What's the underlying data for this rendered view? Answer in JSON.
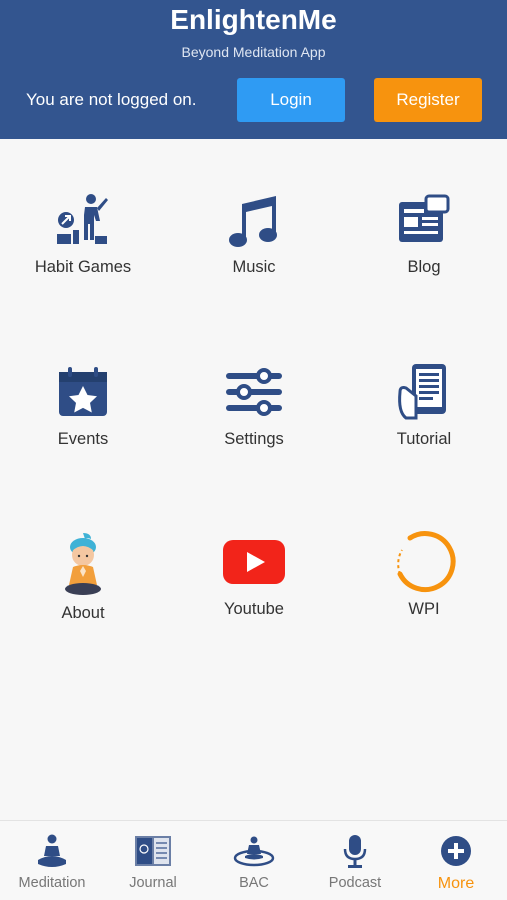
{
  "header": {
    "title": "EnlightenMe",
    "subtitle": "Beyond Meditation App",
    "status_text": "You are not logged on.",
    "login_label": "Login",
    "register_label": "Register"
  },
  "menu": {
    "items": [
      {
        "label": "Habit Games",
        "icon": "habit-games-icon"
      },
      {
        "label": "Music",
        "icon": "music-note-icon"
      },
      {
        "label": "Blog",
        "icon": "blog-icon"
      },
      {
        "label": "Events",
        "icon": "calendar-star-icon"
      },
      {
        "label": "Settings",
        "icon": "sliders-icon"
      },
      {
        "label": "Tutorial",
        "icon": "tablet-hand-icon"
      },
      {
        "label": "About",
        "icon": "meditating-child-icon"
      },
      {
        "label": "Youtube",
        "icon": "youtube-icon"
      },
      {
        "label": "WPI",
        "icon": "orange-ring-icon"
      }
    ]
  },
  "tabbar": {
    "tabs": [
      {
        "label": "Meditation",
        "icon": "meditation-icon"
      },
      {
        "label": "Journal",
        "icon": "journal-icon"
      },
      {
        "label": "BAC",
        "icon": "bac-icon"
      },
      {
        "label": "Podcast",
        "icon": "microphone-icon"
      },
      {
        "label": "More",
        "icon": "plus-circle-icon",
        "active": true
      }
    ]
  },
  "colors": {
    "header_bg": "#33558f",
    "login_button": "#2f9bf3",
    "register_button": "#f7930e",
    "icon_blue": "#2f4d86",
    "active_tab": "#f7930e"
  }
}
